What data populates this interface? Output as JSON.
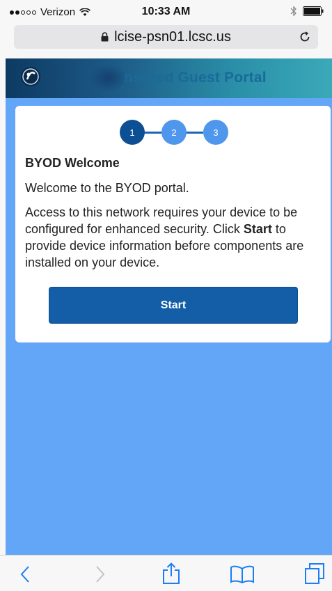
{
  "status_bar": {
    "carrier": "Verizon",
    "time": "10:33 AM",
    "signal_bars_filled": 2,
    "signal_bars_total": 5
  },
  "browser": {
    "url": "lcise-psn01.lcsc.us"
  },
  "portal": {
    "title": "Sponsored Guest Portal",
    "title_visible": "nsored Guest Portal"
  },
  "steps": [
    {
      "label": "1",
      "state": "active"
    },
    {
      "label": "2",
      "state": "pending"
    },
    {
      "label": "3",
      "state": "pending"
    }
  ],
  "card": {
    "title": "BYOD Welcome",
    "welcome": "Welcome to the BYOD portal.",
    "body_prefix": "Access to this network requires your device to be configured for enhanced security. Click ",
    "body_bold": "Start",
    "body_suffix": " to provide device information before components are installed on your device.",
    "start_label": "Start"
  },
  "toolbar": {
    "icons": [
      "back-icon",
      "forward-icon",
      "share-icon",
      "bookmarks-icon",
      "tabs-icon"
    ]
  },
  "colors": {
    "accent": "#0d4f94",
    "step_pending": "#4f97ec",
    "content_bg": "#63a6f7",
    "button": "#135ea6",
    "ios_blue": "#1e7cf5"
  }
}
